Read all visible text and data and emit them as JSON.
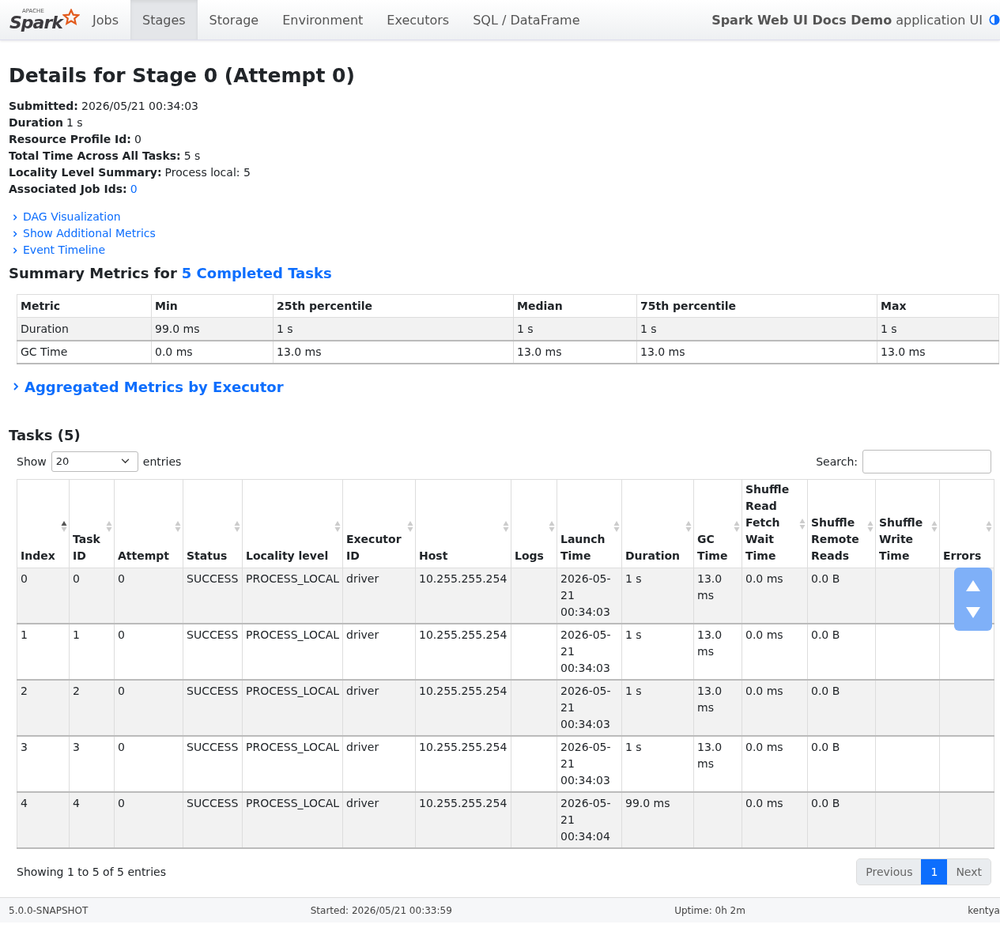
{
  "navbar": {
    "logo": {
      "small": "APACHE",
      "name": "Spark"
    },
    "tabs": [
      {
        "label": "Jobs",
        "selected": false
      },
      {
        "label": "Stages",
        "selected": true
      },
      {
        "label": "Storage",
        "selected": false
      },
      {
        "label": "Environment",
        "selected": false
      },
      {
        "label": "Executors",
        "selected": false
      },
      {
        "label": "SQL / DataFrame",
        "selected": false
      }
    ],
    "app_name": "Spark Web UI Docs Demo",
    "app_suffix": "application UI"
  },
  "title": "Details for Stage 0 (Attempt 0)",
  "details": [
    {
      "label": "Submitted:",
      "value": "2026/05/21 00:34:03",
      "kind": "text"
    },
    {
      "label": "Duration",
      "value": "1 s",
      "kind": "text"
    },
    {
      "label": "Resource Profile Id:",
      "value": "0",
      "kind": "text"
    },
    {
      "label": "Total Time Across All Tasks:",
      "value": "5 s",
      "kind": "text"
    },
    {
      "label": "Locality Level Summary:",
      "value": "Process local: 5",
      "kind": "text"
    },
    {
      "label": "Associated Job Ids:",
      "value": "0",
      "kind": "link"
    }
  ],
  "expanders": [
    "DAG Visualization",
    "Show Additional Metrics",
    "Event Timeline"
  ],
  "summary": {
    "heading": "Summary Metrics for",
    "link": "5 Completed Tasks",
    "columns": [
      "Metric",
      "Min",
      "25th percentile",
      "Median",
      "75th percentile",
      "Max"
    ],
    "rows": [
      [
        "Duration",
        "99.0 ms",
        "1 s",
        "1 s",
        "1 s",
        "1 s"
      ],
      [
        "GC Time",
        "0.0 ms",
        "13.0 ms",
        "13.0 ms",
        "13.0 ms",
        "13.0 ms"
      ]
    ]
  },
  "aggregated": "Aggregated Metrics by Executor",
  "tasks": {
    "heading": "Tasks (5)",
    "show_label": "Show",
    "page_size": "20",
    "entries_label": "entries",
    "search_label": "Search:",
    "columns": [
      {
        "label": "Index",
        "sorted": true
      },
      {
        "label": "Task ID",
        "sorted": false
      },
      {
        "label": "Attempt",
        "sorted": false
      },
      {
        "label": "Status",
        "sorted": false
      },
      {
        "label": "Locality level",
        "sorted": false
      },
      {
        "label": "Executor ID",
        "sorted": false
      },
      {
        "label": "Host",
        "sorted": false
      },
      {
        "label": "Logs",
        "sorted": false
      },
      {
        "label": "Launch Time",
        "sorted": false
      },
      {
        "label": "Duration",
        "sorted": false
      },
      {
        "label": "GC Time",
        "sorted": false
      },
      {
        "label": "Shuffle Read Fetch Wait Time",
        "sorted": false
      },
      {
        "label": "Shuffle Remote Reads",
        "sorted": false
      },
      {
        "label": "Shuffle Write Time",
        "sorted": false
      },
      {
        "label": "Errors",
        "sorted": false
      }
    ],
    "rows": [
      [
        "0",
        "0",
        "0",
        "SUCCESS",
        "PROCESS_LOCAL",
        "driver",
        "10.255.255.254",
        "",
        "2026-05-21 00:34:03",
        "1 s",
        "13.0 ms",
        "0.0 ms",
        "0.0 B",
        "",
        ""
      ],
      [
        "1",
        "1",
        "0",
        "SUCCESS",
        "PROCESS_LOCAL",
        "driver",
        "10.255.255.254",
        "",
        "2026-05-21 00:34:03",
        "1 s",
        "13.0 ms",
        "0.0 ms",
        "0.0 B",
        "",
        ""
      ],
      [
        "2",
        "2",
        "0",
        "SUCCESS",
        "PROCESS_LOCAL",
        "driver",
        "10.255.255.254",
        "",
        "2026-05-21 00:34:03",
        "1 s",
        "13.0 ms",
        "0.0 ms",
        "0.0 B",
        "",
        ""
      ],
      [
        "3",
        "3",
        "0",
        "SUCCESS",
        "PROCESS_LOCAL",
        "driver",
        "10.255.255.254",
        "",
        "2026-05-21 00:34:03",
        "1 s",
        "13.0 ms",
        "0.0 ms",
        "0.0 B",
        "",
        ""
      ],
      [
        "4",
        "4",
        "0",
        "SUCCESS",
        "PROCESS_LOCAL",
        "driver",
        "10.255.255.254",
        "",
        "2026-05-21 00:34:04",
        "99.0 ms",
        "",
        "0.0 ms",
        "0.0 B",
        "",
        ""
      ]
    ],
    "info": "Showing 1 to 5 of 5 entries",
    "pagination": [
      {
        "label": "Previous",
        "selected": false
      },
      {
        "label": "1",
        "selected": true
      },
      {
        "label": "Next",
        "selected": false
      }
    ]
  },
  "footer": [
    "5.0.0-SNAPSHOT",
    "Started: 2026/05/21 00:33:59",
    "Uptime: 0h 2m",
    "kentya"
  ]
}
